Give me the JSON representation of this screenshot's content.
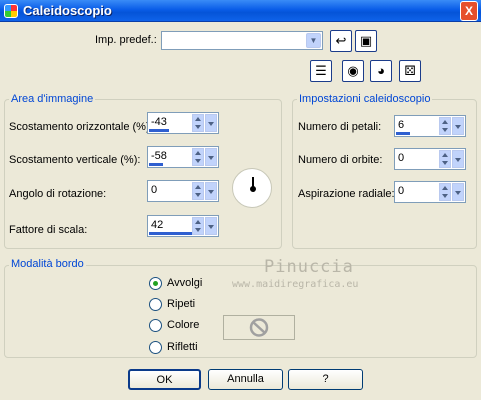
{
  "window": {
    "title": "Caleidoscopio",
    "close_glyph": "X"
  },
  "preset": {
    "label": "Imp. predef.:",
    "value": ""
  },
  "area": {
    "title": "Area d'immagine",
    "fields": [
      {
        "label": "Scostamento orizzontale (%):",
        "value": "-43",
        "fill": 0.2
      },
      {
        "label": "Scostamento verticale (%):",
        "value": "-58",
        "fill": 0.3
      },
      {
        "label": "Angolo di rotazione:",
        "value": "0",
        "fill": 0.0
      },
      {
        "label": "Fattore di scala:",
        "value": "42",
        "fill": 1.0
      }
    ]
  },
  "settings": {
    "title": "Impostazioni caleidoscopio",
    "fields": [
      {
        "label": "Numero di petali:",
        "value": "6",
        "fill": 0.3
      },
      {
        "label": "Numero di orbite:",
        "value": "0",
        "fill": 0.0
      },
      {
        "label": "Aspirazione radiale:",
        "value": "0",
        "fill": 0.0
      }
    ]
  },
  "edge": {
    "title": "Modalità bordo",
    "options": [
      {
        "label": "Avvolgi",
        "selected": true
      },
      {
        "label": "Ripeti",
        "selected": false
      },
      {
        "label": "Colore",
        "selected": false
      },
      {
        "label": "Rifletti",
        "selected": false
      }
    ]
  },
  "watermark": {
    "name": "Pinuccia",
    "site": "www.maidiregrafica.eu"
  },
  "buttons": {
    "ok": "OK",
    "cancel": "Annulla",
    "help": "?"
  },
  "colors": {
    "title_bar": "#0a5de8",
    "group_title": "#0046d5",
    "bar_fill": "#2f5fd0"
  }
}
